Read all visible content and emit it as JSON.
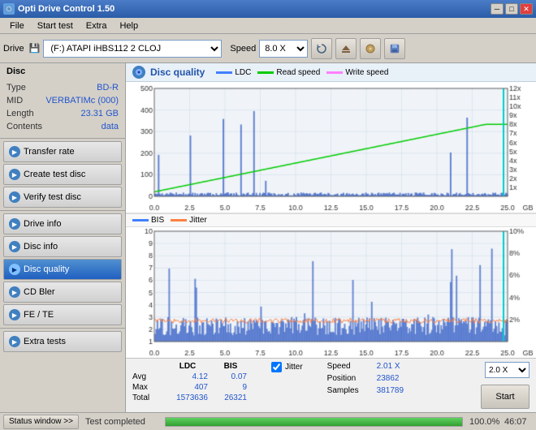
{
  "titlebar": {
    "title": "Opti Drive Control 1.50",
    "min_label": "─",
    "max_label": "□",
    "close_label": "✕"
  },
  "menubar": {
    "items": [
      "File",
      "Start test",
      "Extra",
      "Help"
    ]
  },
  "toolbar": {
    "drive_label": "Drive",
    "drive_value": "(F:)  ATAPI iHBS112  2 CLOJ",
    "speed_label": "Speed",
    "speed_value": "8.0 X"
  },
  "disc": {
    "section_label": "Disc",
    "type_label": "Type",
    "type_value": "BD-R",
    "mid_label": "MID",
    "mid_value": "VERBATIMc (000)",
    "length_label": "Length",
    "length_value": "23.31 GB",
    "contents_label": "Contents",
    "contents_value": "data"
  },
  "sidebar_buttons": [
    {
      "id": "transfer-rate",
      "label": "Transfer rate",
      "active": false
    },
    {
      "id": "create-test-disc",
      "label": "Create test disc",
      "active": false
    },
    {
      "id": "verify-test-disc",
      "label": "Verify test disc",
      "active": false
    },
    {
      "id": "drive-info",
      "label": "Drive info",
      "active": false
    },
    {
      "id": "disc-info",
      "label": "Disc info",
      "active": false
    },
    {
      "id": "disc-quality",
      "label": "Disc quality",
      "active": true
    },
    {
      "id": "cd-bler",
      "label": "CD Bler",
      "active": false
    },
    {
      "id": "fe-te",
      "label": "FE / TE",
      "active": false
    },
    {
      "id": "extra-tests",
      "label": "Extra tests",
      "active": false
    }
  ],
  "chart": {
    "title": "Disc quality",
    "legend": {
      "ldc_label": "LDC",
      "read_label": "Read speed",
      "write_label": "Write speed",
      "bis_label": "BIS",
      "jitter_label": "Jitter"
    }
  },
  "stats": {
    "ldc_header": "LDC",
    "bis_header": "BIS",
    "avg_label": "Avg",
    "max_label": "Max",
    "total_label": "Total",
    "avg_ldc": "4.12",
    "avg_bis": "0.07",
    "max_ldc": "407",
    "max_bis": "9",
    "total_ldc": "1573636",
    "total_bis": "26321",
    "jitter_label": "Jitter",
    "speed_label": "Speed",
    "speed_value": "2.01 X",
    "position_label": "Position",
    "position_value": "23862",
    "samples_label": "Samples",
    "samples_value": "381789",
    "start_label": "Start",
    "speed_select_value": "2.0 X"
  },
  "statusbar": {
    "window_btn_label": "Status window >>",
    "status_text": "Test completed",
    "progress": "100.0%",
    "time": "46:07"
  }
}
